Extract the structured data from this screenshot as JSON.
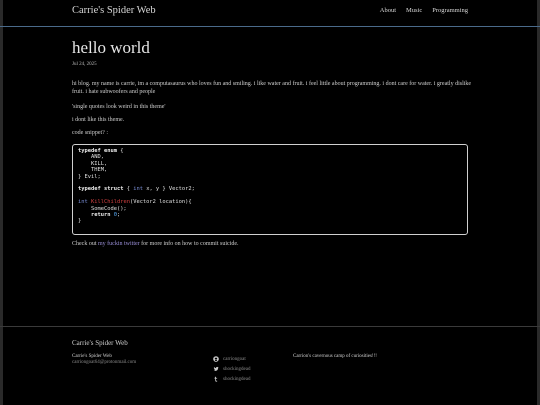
{
  "header": {
    "site_title": "Carrie's Spider Web",
    "nav": [
      "About",
      "Music",
      "Programming"
    ]
  },
  "post": {
    "title": "hello world",
    "date": "Jul 24, 2025",
    "p1": "hi blog. my name is carrie, im a computasaurus who loves fun and smiling. i like water and fruit. i feel little about programming. i dont care for water. i greatly dislike fruit. i hate subwoofers and people",
    "p2": "'single quotes look weird in this theme'",
    "p3": "i dont like this theme.",
    "p4": "code snippet? :",
    "outro_before": "Check out ",
    "outro_link": "my fuckin twitter",
    "outro_after": " for more info on how to commit suicide."
  },
  "code": {
    "l1a": "typedef",
    "l1b": "enum",
    "l1c": " {",
    "l2": "    AND,",
    "l3": "    KILL,",
    "l4": "    THEM,",
    "l5": "} Evil;",
    "l7a": "typedef",
    "l7b": "struct",
    "l7c": " { ",
    "l7d": "int",
    "l7e": " x, y } Vector2;",
    "l9a": "int",
    "l9b": " ",
    "l9c": "KillChildren",
    "l9d": "(Vector2 location){",
    "l10": "    SomeCode();",
    "l11a": "    ",
    "l11b": "return",
    "l11c": " ",
    "l11d": "0",
    "l11e": ";",
    "l12": "}"
  },
  "footer": {
    "title": "Carrie's Spider Web",
    "name": "Carrie's Spider Web",
    "email": "carriongoat64@protonmail.com",
    "social": [
      {
        "icon": "github-icon",
        "label": "carriongoat"
      },
      {
        "icon": "twitter-icon",
        "label": "shockingdead"
      },
      {
        "icon": "tumblr-icon",
        "label": "shockingdead"
      }
    ],
    "description": "Carrion's cavernous camp of curiosities!!!"
  }
}
